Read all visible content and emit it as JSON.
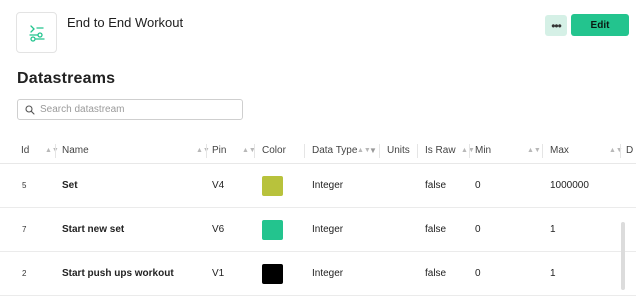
{
  "header": {
    "title": "End to End Workout",
    "more_label": "•••",
    "edit_label": "Edit"
  },
  "section": {
    "heading": "Datastreams"
  },
  "search": {
    "placeholder": "Search datastream",
    "value": ""
  },
  "table": {
    "columns": {
      "id": "Id",
      "name": "Name",
      "pin": "Pin",
      "color": "Color",
      "data_type": "Data Type",
      "units": "Units",
      "is_raw": "Is Raw",
      "min": "Min",
      "max": "Max",
      "next": "D"
    },
    "rows": [
      {
        "id": "5",
        "name": "Set",
        "pin": "V4",
        "color": "#b8c23c",
        "data_type": "Integer",
        "units": "",
        "is_raw": "false",
        "min": "0",
        "max": "1000000"
      },
      {
        "id": "7",
        "name": "Start new set",
        "pin": "V6",
        "color": "#23c48e",
        "data_type": "Integer",
        "units": "",
        "is_raw": "false",
        "min": "0",
        "max": "1"
      },
      {
        "id": "2",
        "name": "Start push ups workout",
        "pin": "V1",
        "color": "#000000",
        "data_type": "Integer",
        "units": "",
        "is_raw": "false",
        "min": "0",
        "max": "1"
      }
    ]
  },
  "icons": {
    "logo": "device-logo-icon",
    "search": "search-icon",
    "sort": "sort-icon",
    "filter": "filter-icon"
  }
}
